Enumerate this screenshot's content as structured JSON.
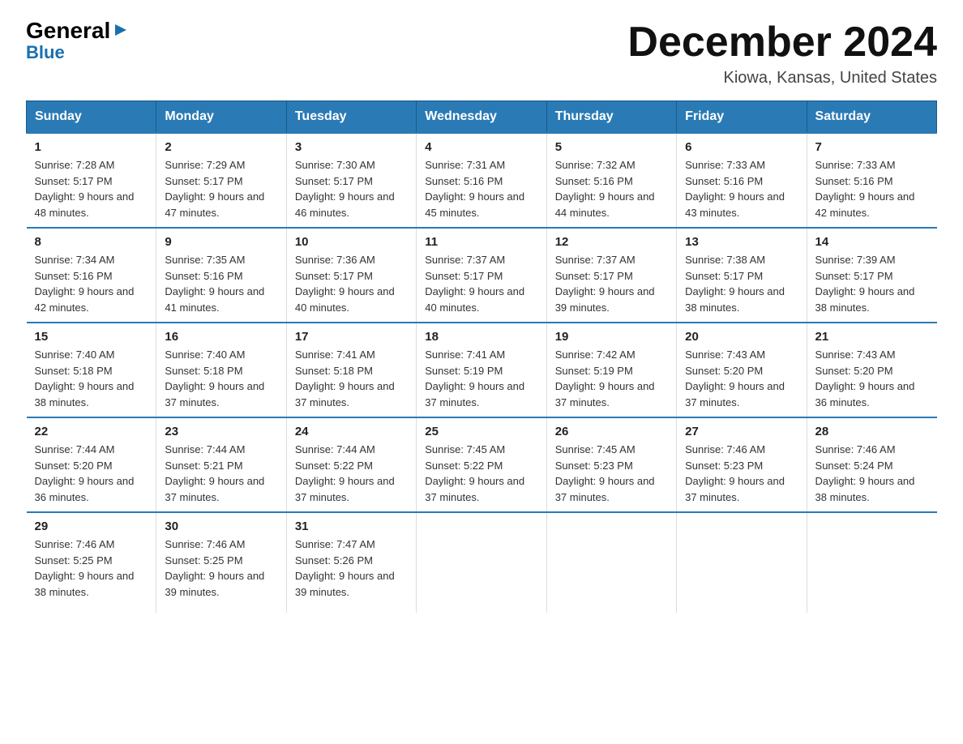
{
  "logo": {
    "line1": "General",
    "arrow": "▶",
    "line2": "Blue"
  },
  "title": "December 2024",
  "subtitle": "Kiowa, Kansas, United States",
  "headers": [
    "Sunday",
    "Monday",
    "Tuesday",
    "Wednesday",
    "Thursday",
    "Friday",
    "Saturday"
  ],
  "weeks": [
    [
      {
        "day": "1",
        "sunrise": "7:28 AM",
        "sunset": "5:17 PM",
        "daylight": "9 hours and 48 minutes."
      },
      {
        "day": "2",
        "sunrise": "7:29 AM",
        "sunset": "5:17 PM",
        "daylight": "9 hours and 47 minutes."
      },
      {
        "day": "3",
        "sunrise": "7:30 AM",
        "sunset": "5:17 PM",
        "daylight": "9 hours and 46 minutes."
      },
      {
        "day": "4",
        "sunrise": "7:31 AM",
        "sunset": "5:16 PM",
        "daylight": "9 hours and 45 minutes."
      },
      {
        "day": "5",
        "sunrise": "7:32 AM",
        "sunset": "5:16 PM",
        "daylight": "9 hours and 44 minutes."
      },
      {
        "day": "6",
        "sunrise": "7:33 AM",
        "sunset": "5:16 PM",
        "daylight": "9 hours and 43 minutes."
      },
      {
        "day": "7",
        "sunrise": "7:33 AM",
        "sunset": "5:16 PM",
        "daylight": "9 hours and 42 minutes."
      }
    ],
    [
      {
        "day": "8",
        "sunrise": "7:34 AM",
        "sunset": "5:16 PM",
        "daylight": "9 hours and 42 minutes."
      },
      {
        "day": "9",
        "sunrise": "7:35 AM",
        "sunset": "5:16 PM",
        "daylight": "9 hours and 41 minutes."
      },
      {
        "day": "10",
        "sunrise": "7:36 AM",
        "sunset": "5:17 PM",
        "daylight": "9 hours and 40 minutes."
      },
      {
        "day": "11",
        "sunrise": "7:37 AM",
        "sunset": "5:17 PM",
        "daylight": "9 hours and 40 minutes."
      },
      {
        "day": "12",
        "sunrise": "7:37 AM",
        "sunset": "5:17 PM",
        "daylight": "9 hours and 39 minutes."
      },
      {
        "day": "13",
        "sunrise": "7:38 AM",
        "sunset": "5:17 PM",
        "daylight": "9 hours and 38 minutes."
      },
      {
        "day": "14",
        "sunrise": "7:39 AM",
        "sunset": "5:17 PM",
        "daylight": "9 hours and 38 minutes."
      }
    ],
    [
      {
        "day": "15",
        "sunrise": "7:40 AM",
        "sunset": "5:18 PM",
        "daylight": "9 hours and 38 minutes."
      },
      {
        "day": "16",
        "sunrise": "7:40 AM",
        "sunset": "5:18 PM",
        "daylight": "9 hours and 37 minutes."
      },
      {
        "day": "17",
        "sunrise": "7:41 AM",
        "sunset": "5:18 PM",
        "daylight": "9 hours and 37 minutes."
      },
      {
        "day": "18",
        "sunrise": "7:41 AM",
        "sunset": "5:19 PM",
        "daylight": "9 hours and 37 minutes."
      },
      {
        "day": "19",
        "sunrise": "7:42 AM",
        "sunset": "5:19 PM",
        "daylight": "9 hours and 37 minutes."
      },
      {
        "day": "20",
        "sunrise": "7:43 AM",
        "sunset": "5:20 PM",
        "daylight": "9 hours and 37 minutes."
      },
      {
        "day": "21",
        "sunrise": "7:43 AM",
        "sunset": "5:20 PM",
        "daylight": "9 hours and 36 minutes."
      }
    ],
    [
      {
        "day": "22",
        "sunrise": "7:44 AM",
        "sunset": "5:20 PM",
        "daylight": "9 hours and 36 minutes."
      },
      {
        "day": "23",
        "sunrise": "7:44 AM",
        "sunset": "5:21 PM",
        "daylight": "9 hours and 37 minutes."
      },
      {
        "day": "24",
        "sunrise": "7:44 AM",
        "sunset": "5:22 PM",
        "daylight": "9 hours and 37 minutes."
      },
      {
        "day": "25",
        "sunrise": "7:45 AM",
        "sunset": "5:22 PM",
        "daylight": "9 hours and 37 minutes."
      },
      {
        "day": "26",
        "sunrise": "7:45 AM",
        "sunset": "5:23 PM",
        "daylight": "9 hours and 37 minutes."
      },
      {
        "day": "27",
        "sunrise": "7:46 AM",
        "sunset": "5:23 PM",
        "daylight": "9 hours and 37 minutes."
      },
      {
        "day": "28",
        "sunrise": "7:46 AM",
        "sunset": "5:24 PM",
        "daylight": "9 hours and 38 minutes."
      }
    ],
    [
      {
        "day": "29",
        "sunrise": "7:46 AM",
        "sunset": "5:25 PM",
        "daylight": "9 hours and 38 minutes."
      },
      {
        "day": "30",
        "sunrise": "7:46 AM",
        "sunset": "5:25 PM",
        "daylight": "9 hours and 39 minutes."
      },
      {
        "day": "31",
        "sunrise": "7:47 AM",
        "sunset": "5:26 PM",
        "daylight": "9 hours and 39 minutes."
      },
      null,
      null,
      null,
      null
    ]
  ]
}
